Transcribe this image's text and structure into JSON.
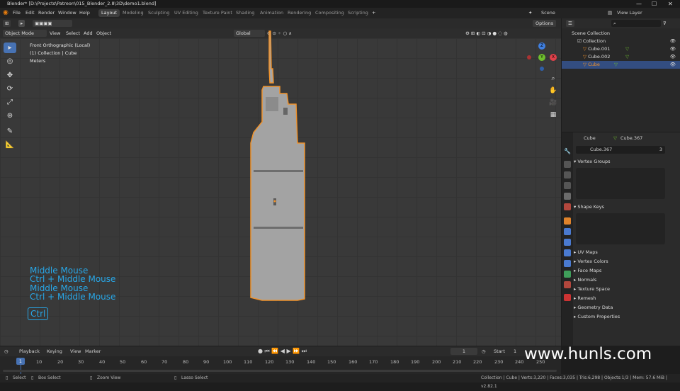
{
  "titlebar": {
    "title": "Blender* [D:\\Projects\\Patreon\\015_Blender_2.8\\3D\\demo1.blend]",
    "minimize": "—",
    "maximize": "☐",
    "close": "✕"
  },
  "menu": [
    "File",
    "Edit",
    "Render",
    "Window",
    "Help"
  ],
  "workspaces": [
    "Layout",
    "Modeling",
    "Sculpting",
    "UV Editing",
    "Texture Paint",
    "Shading",
    "Animation",
    "Rendering",
    "Compositing",
    "Scripting"
  ],
  "workspace_add": "+",
  "scene": "Scene",
  "view_layer": "View Layer",
  "viewport_header": {
    "mode": "Object Mode",
    "menus": [
      "View",
      "Select",
      "Add",
      "Object"
    ],
    "orientation": "Global",
    "options": "Options"
  },
  "viewport_info": [
    "Front Orthographic (Local)",
    "(1) Collection | Cube",
    "Meters"
  ],
  "key_hints": [
    "Middle Mouse",
    "Ctrl + Middle Mouse",
    "Middle Mouse",
    "Ctrl + Middle Mouse"
  ],
  "key_pressed": "Ctrl",
  "gizmo": {
    "z": "Z",
    "y": "Y",
    "x": "X"
  },
  "outliner": {
    "scene_collection": "Scene Collection",
    "collection": "Collection",
    "items": [
      "Cube.001",
      "Cube.002",
      "Cube"
    ]
  },
  "properties": {
    "object": "Cube",
    "mesh": "Cube.367",
    "mesh_field": "Cube.367",
    "users": "3",
    "panels_open": [
      "Vertex Groups",
      "Shape Keys"
    ],
    "panels": [
      "UV Maps",
      "Vertex Colors",
      "Face Maps",
      "Normals",
      "Texture Space",
      "Remesh",
      "Geometry Data",
      "Custom Properties"
    ]
  },
  "timeline": {
    "menus": [
      "Playback",
      "Keying",
      "View",
      "Marker"
    ],
    "current_frame": "1",
    "start_label": "Start",
    "start": "1",
    "ticks": [
      "10",
      "20",
      "30",
      "40",
      "50",
      "60",
      "70",
      "80",
      "90",
      "100",
      "110",
      "120",
      "130",
      "140",
      "150",
      "160",
      "170",
      "180",
      "190",
      "200",
      "210",
      "220",
      "230",
      "240",
      "250"
    ],
    "cursor": "1"
  },
  "statusbar": {
    "left": [
      "Select",
      "Box Select",
      "Zoom View",
      "Lasso Select"
    ],
    "right": "Collection | Cube | Verts:3,220 | Faces:3,035 | Tris:6,298 | Objects:1/3 | Mem: 57.6 MiB | v2.82.1"
  },
  "watermark": "www.hunls.com",
  "colors": {
    "accent": "#4772b3",
    "selection": "#f0922b",
    "hint": "#28a6e6",
    "x_axis": "#e0414a",
    "y_axis": "#6fbe2e",
    "z_axis": "#3f7fe0"
  }
}
